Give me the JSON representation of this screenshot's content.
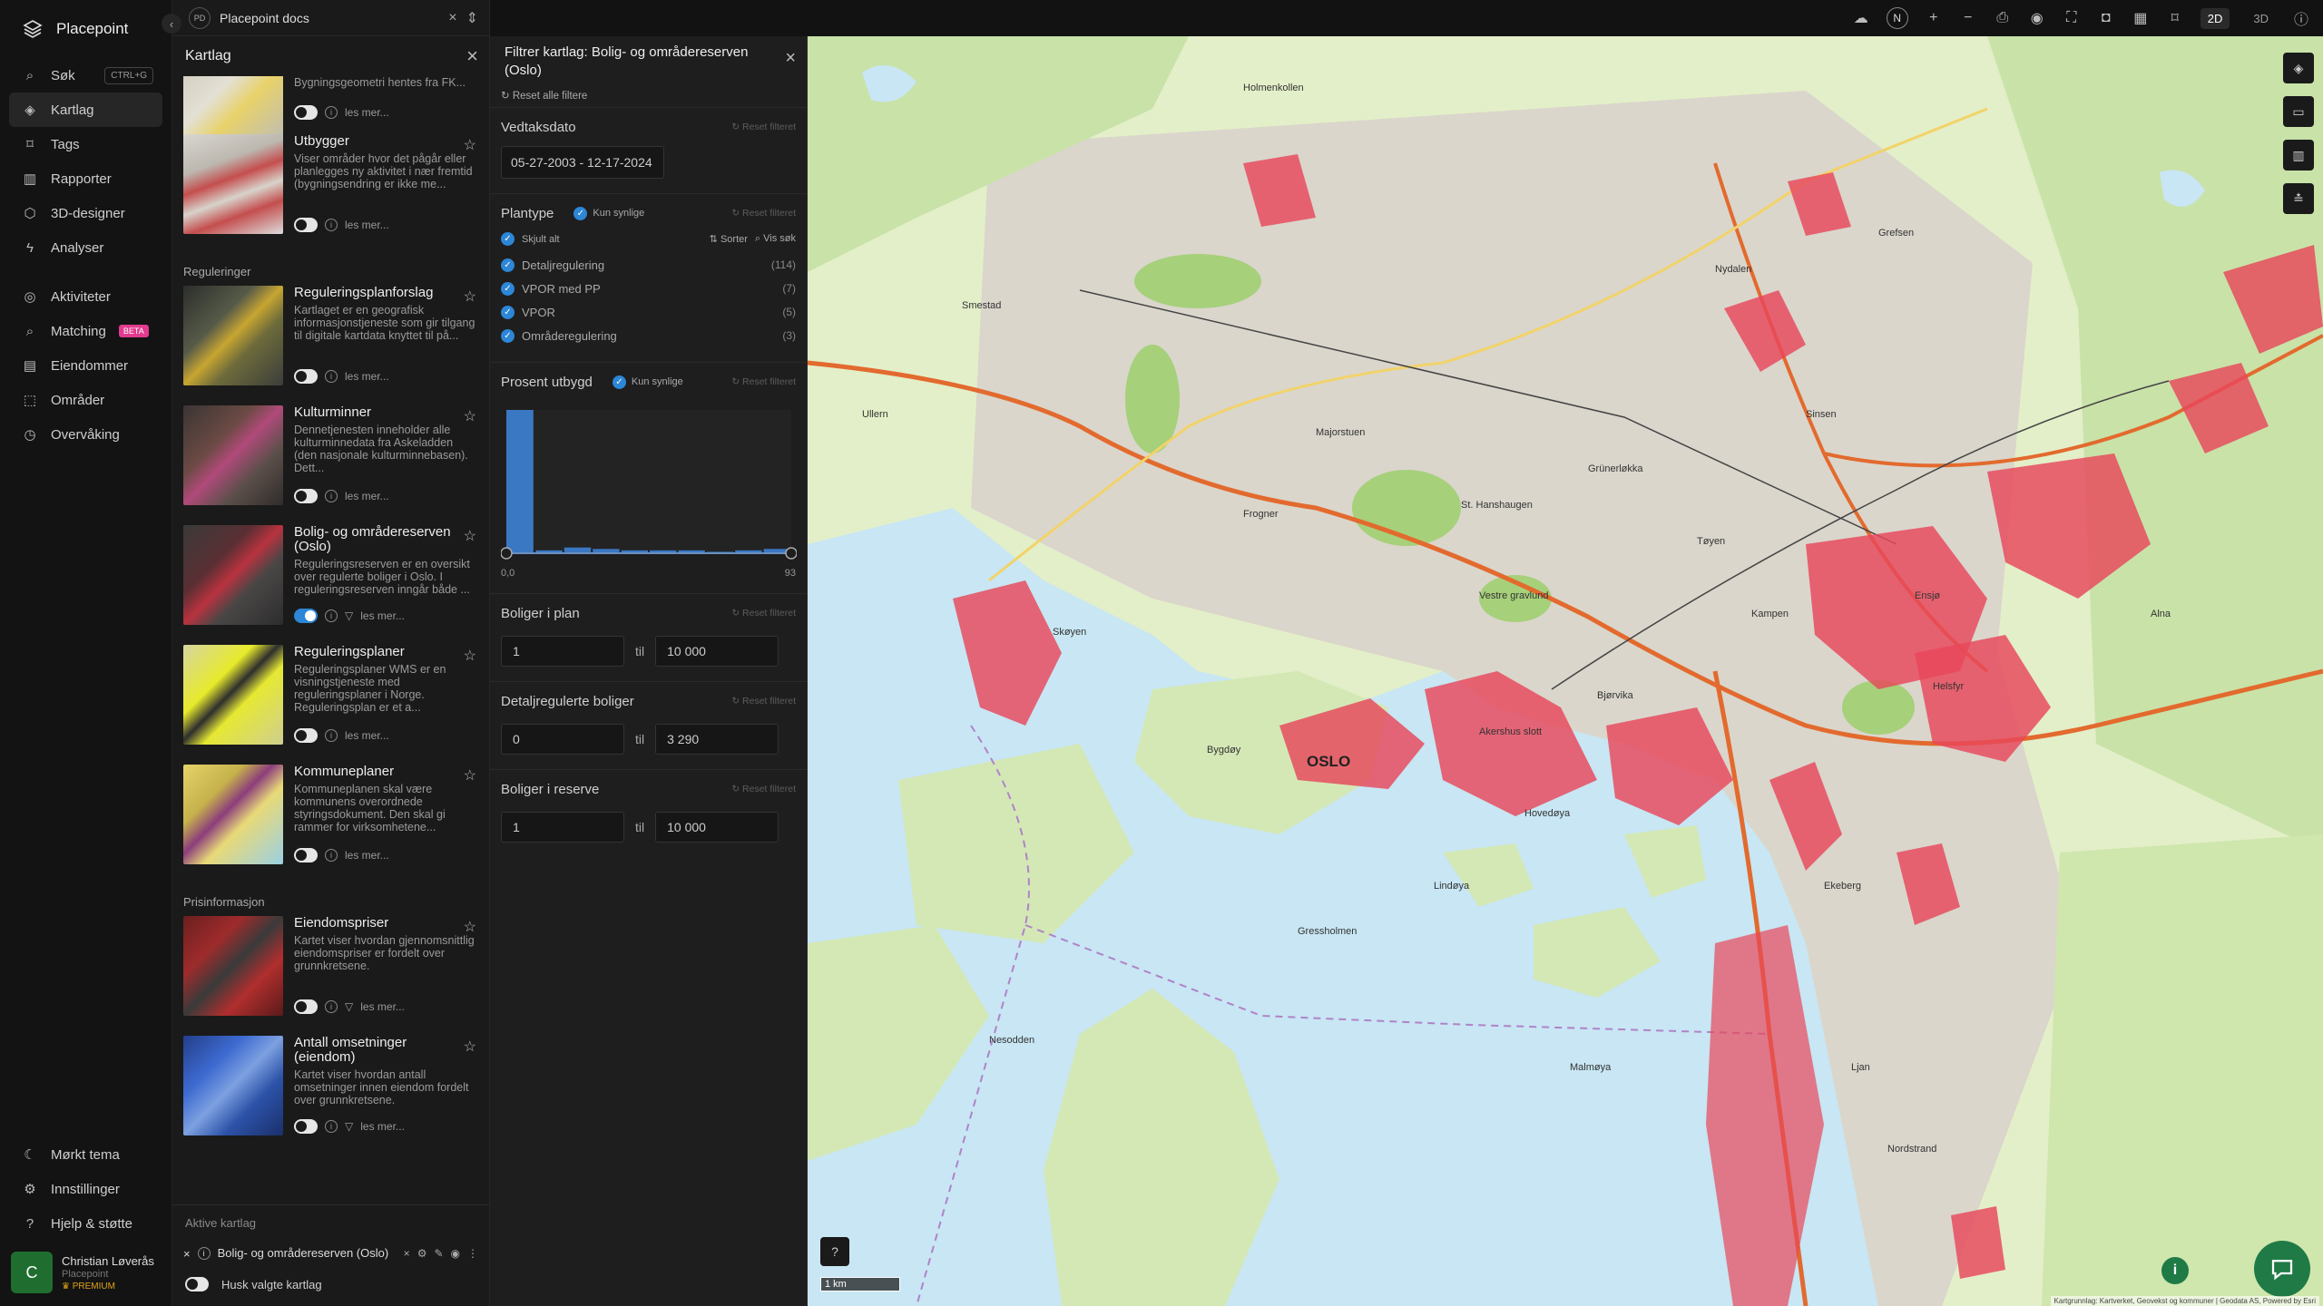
{
  "nav": {
    "brand": "Placepoint",
    "items": [
      {
        "label": "Søk",
        "kbd": "CTRL+G"
      },
      {
        "label": "Kartlag"
      },
      {
        "label": "Tags"
      },
      {
        "label": "Rapporter"
      },
      {
        "label": "3D-designer"
      },
      {
        "label": "Analyser"
      },
      {
        "label": "Aktiviteter"
      },
      {
        "label": "Matching",
        "badge": "BETA"
      },
      {
        "label": "Eiendommer"
      },
      {
        "label": "Områder"
      },
      {
        "label": "Overvåking"
      }
    ],
    "bottom": [
      {
        "label": "Mørkt tema"
      },
      {
        "label": "Innstillinger"
      },
      {
        "label": "Hjelp & støtte"
      }
    ],
    "user": {
      "initial": "C",
      "name": "Christian Løverås",
      "org": "Placepoint",
      "plan": "PREMIUM"
    }
  },
  "doc": {
    "badge": "PD",
    "title": "Placepoint docs"
  },
  "layers_panel": {
    "title": "Kartlag",
    "first_layer_desc": "Viser alle bygningstyper som kan forbindes med bolig fra Matrikkelen. Bygningsgeometri hentes fra FK...",
    "read_more": "les mer...",
    "items": [
      {
        "title": "Utbygger",
        "desc": "Viser områder hvor det pågår eller planlegges ny aktivitet i nær fremtid (bygningsendring er ikke me..."
      },
      {
        "title": "Reguleringsplanforslag",
        "desc": "Kartlaget er en geografisk informasjonstjeneste som gir tilgang til digitale kartdata knyttet til på..."
      },
      {
        "title": "Kulturminner",
        "desc": "Dennetjenesten inneholder alle kulturminnedata fra Askeladden (den nasjonale kulturminnebasen). Dett..."
      },
      {
        "title": "Bolig- og områdereserven (Oslo)",
        "desc": "Reguleringsreserven er en oversikt over regulerte boliger i Oslo. I reguleringsreserven inngår både ..."
      },
      {
        "title": "Reguleringsplaner",
        "desc": "Reguleringsplaner WMS er en visningstjeneste med reguleringsplaner i Norge. Reguleringsplan er et a..."
      },
      {
        "title": "Kommuneplaner",
        "desc": "Kommuneplanen skal være kommunens overordnede styringsdokument. Den skal gi rammer for virksomhetene..."
      },
      {
        "title": "Eiendomspriser",
        "desc": "Kartet viser hvordan gjennomsnittlig eiendomspriser er fordelt over grunnkretsene."
      },
      {
        "title": "Antall omsetninger (eiendom)",
        "desc": "Kartet viser hvordan antall omsetninger innen eiendom fordelt over grunnkretsene."
      }
    ],
    "sections": {
      "reguleringer": "Reguleringer",
      "prisinformasjon": "Prisinformasjon"
    },
    "active": {
      "title": "Aktive kartlag",
      "name": "Bolig- og områdereserven (Oslo)"
    },
    "remember": "Husk valgte kartlag"
  },
  "filter": {
    "title": "Filtrer kartlag: Bolig- og områdereserven (Oslo)",
    "reset_all": "Reset alle filtere",
    "reset": "Reset filteret",
    "only_visible": "Kun synlige",
    "vedtaksdato": {
      "label": "Vedtaksdato",
      "value": "05-27-2003 - 12-17-2024"
    },
    "plantype": {
      "label": "Plantype",
      "hide_all": "Skjult alt",
      "sort": "Sorter",
      "search": "Vis søk",
      "rows": [
        {
          "label": "Detaljregulering",
          "count": "(114)"
        },
        {
          "label": "VPOR med PP",
          "count": "(7)"
        },
        {
          "label": "VPOR",
          "count": "(5)"
        },
        {
          "label": "Områderegulering",
          "count": "(3)"
        }
      ]
    },
    "prosent": {
      "label": "Prosent utbygd",
      "min": "0,0",
      "max": "93"
    },
    "boliger_plan": {
      "label": "Boliger i plan",
      "from": "1",
      "til": "til",
      "to": "10 000"
    },
    "detalj": {
      "label": "Detaljregulerte boliger",
      "from": "0",
      "til": "til",
      "to": "3 290"
    },
    "reserve": {
      "label": "Boliger i reserve",
      "from": "1",
      "til": "til",
      "to": "10 000"
    }
  },
  "chart_data": {
    "type": "bar",
    "title": "",
    "x": [
      0,
      10,
      20,
      30,
      40,
      50,
      60,
      70,
      80,
      90
    ],
    "values": [
      100,
      2,
      4,
      3,
      2,
      2,
      2,
      1,
      2,
      3
    ],
    "xlim": [
      0,
      93
    ],
    "ylim": [
      0,
      100
    ],
    "xlabel": "",
    "ylabel": ""
  },
  "map": {
    "city_label": "OSLO",
    "scale": "1 km",
    "attribution": "Kartgrunnlag: Kartverket, Geovekst og kommuner | Geodata AS, Powered by Esri",
    "modes": [
      "2D",
      "3D"
    ],
    "north": "N",
    "places": [
      "Ullern",
      "Smestad",
      "Frogner",
      "Majorstuen",
      "St. Hanshaugen",
      "Grünerløkka",
      "Tøyen",
      "Helsfyr",
      "Ekeberg",
      "Bygdøy",
      "Skøyen",
      "Sinsen",
      "Nydalen",
      "Hovedøya",
      "Nesodden",
      "Ljan",
      "Malmøya",
      "Lindøya",
      "Gressholmen",
      "Bjørvika",
      "Grefsen",
      "Kampen",
      "Ensjø",
      "Holmenkollen",
      "Akershus slott",
      "Vestre gravlund",
      "Alna",
      "Nordstrand"
    ],
    "colors": {
      "water": "#c8e6f4",
      "land": "#e3efc8",
      "urban": "#dad6cc",
      "park": "#a6d07a",
      "reserve": "#e8475a",
      "road": "#e36a2e"
    }
  }
}
